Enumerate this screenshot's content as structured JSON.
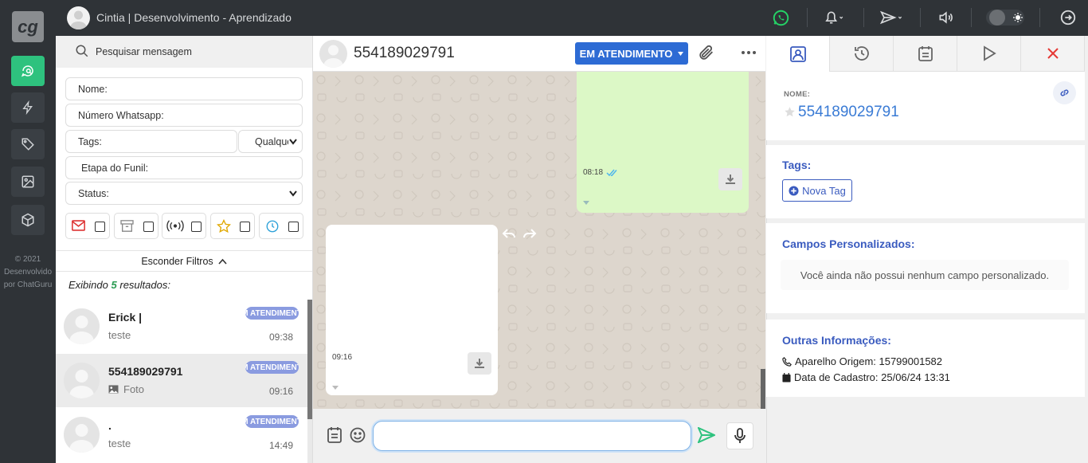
{
  "app": {
    "logo_text": "cg",
    "copyright": "© 2021 Desenvolvido por ChatGuru",
    "top_title": "Cintia | Desenvolvimento - Aprendizado"
  },
  "colors": {
    "rail": "#2f3337",
    "accent_green": "#2ec27e",
    "primary_blue": "#2d6bd4",
    "badge": "#8a9be0",
    "sent_bubble": "#dcf8c6"
  },
  "rail_icons": [
    "chat-search-icon",
    "bolt-icon",
    "tag-icon",
    "image-icon",
    "cube-icon"
  ],
  "top_icons": [
    "whatsapp-icon",
    "bell-icon",
    "send-icon",
    "volume-icon",
    "theme-toggle",
    "logout-icon"
  ],
  "sidebar": {
    "search_placeholder": "Pesquisar mensagem",
    "filters": {
      "nome": "Nome:",
      "numero": "Número Whatsapp:",
      "tags": "Tags:",
      "tags_mode": "Qualquer",
      "etapa": "Etapa do Funil:",
      "status": "Status:"
    },
    "filter_icons": [
      "mail-icon",
      "archive-icon",
      "broadcast-icon",
      "star-icon",
      "clock-icon"
    ],
    "hide_filters": "Esconder Filtros",
    "results_prefix": "Exibindo",
    "results_count": "5",
    "results_suffix": "resultados:",
    "chats": [
      {
        "name": "Erick |",
        "preview": "teste",
        "badge": "EM ATENDIMENTO",
        "time": "09:38"
      },
      {
        "name": "554189029791",
        "preview": "Foto",
        "badge": "EM ATENDIMENTO",
        "time": "09:16"
      },
      {
        "name": ".",
        "preview": "teste",
        "badge": "EM ATENDIMENTO",
        "time": "14:49"
      }
    ]
  },
  "chat": {
    "contact": "554189029791",
    "status_button": "EM ATENDIMENTO",
    "messages": [
      {
        "direction": "out",
        "time": "08:18"
      },
      {
        "direction": "in",
        "time": "09:16"
      }
    ],
    "input_value": ""
  },
  "panel": {
    "tabs": [
      "contact-tab",
      "history-tab",
      "notes-tab",
      "play-tab",
      "close-tab"
    ],
    "nome_label": "NOME:",
    "nome_value": "554189029791",
    "tags_title": "Tags:",
    "nova_tag": "Nova Tag",
    "campos_title": "Campos Personalizados:",
    "campos_empty": "Você ainda não possui nenhum campo personalizado.",
    "outras_title": "Outras Informações:",
    "aparelho": "Aparelho Origem: 15799001582",
    "cadastro": "Data de Cadastro: 25/06/24 13:31"
  }
}
